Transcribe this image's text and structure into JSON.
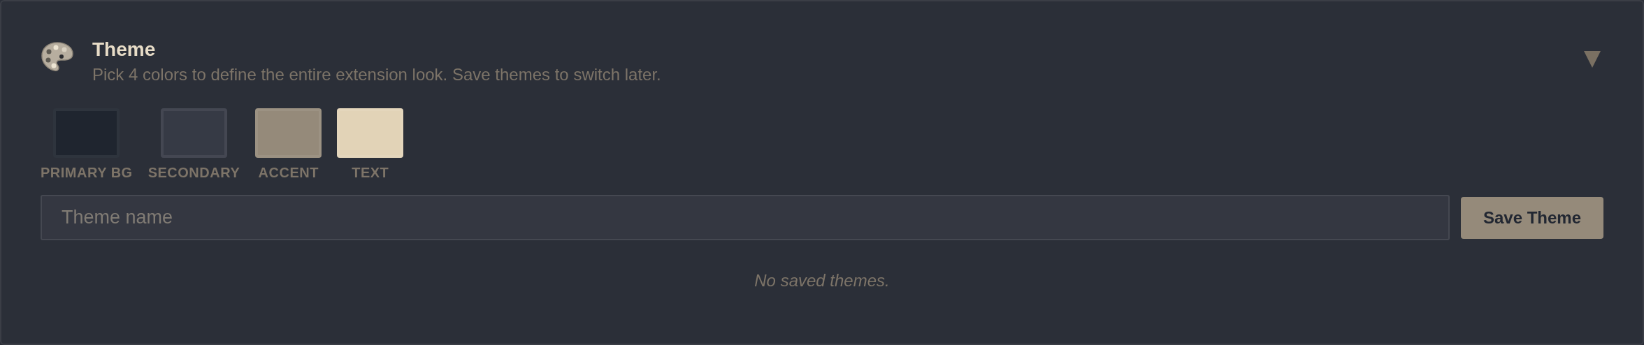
{
  "header": {
    "title": "Theme",
    "description": "Pick 4 colors to define the entire extension look. Save themes to switch later.",
    "expanded": true
  },
  "swatches": [
    {
      "label": "PRIMARY BG",
      "color": "#1f252f"
    },
    {
      "label": "SECONDARY",
      "color": "#363a45"
    },
    {
      "label": "ACCENT",
      "color": "#958a7a"
    },
    {
      "label": "TEXT",
      "color": "#e2d3b7"
    }
  ],
  "name_field": {
    "placeholder": "Theme name"
  },
  "save_button": "Save Theme",
  "empty_message": "No saved themes."
}
